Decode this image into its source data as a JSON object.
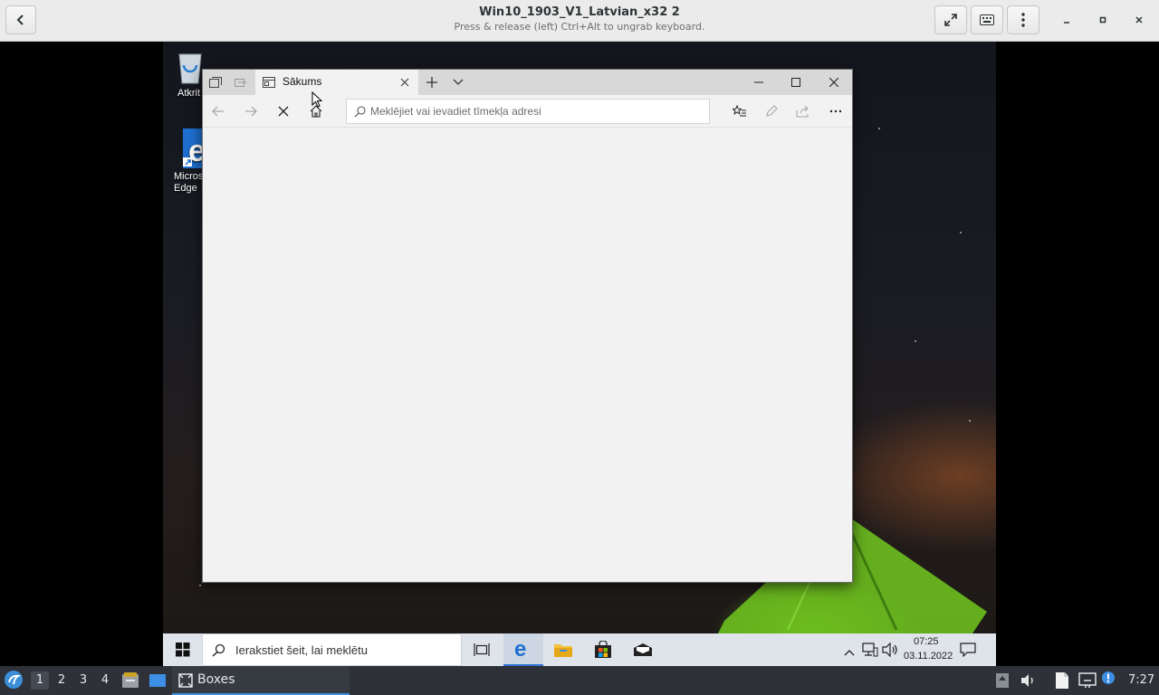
{
  "header": {
    "title": "Win10_1903_V1_Latvian_x32 2",
    "subtitle": "Press & release (left) Ctrl+Alt to ungrab keyboard.",
    "icons": {
      "back": "back-icon",
      "fullscreen": "fullscreen-icon",
      "keyboard": "keyboard-icon",
      "menu": "menu-icon",
      "minimize": "minimize-icon",
      "maximize": "maximize-icon",
      "close": "close-icon"
    }
  },
  "desktop": {
    "icons": [
      {
        "label": "Atkrit",
        "icon": "recycle-bin-icon"
      },
      {
        "label": "Micros Edge",
        "icon": "edge-icon"
      }
    ]
  },
  "edge": {
    "tab": {
      "title": "Sākums"
    },
    "address_placeholder": "Meklējiet vai ievadiet tīmekļa adresi",
    "toolbar_icons": [
      "back-arrow-icon",
      "forward-arrow-icon",
      "stop-icon",
      "home-icon",
      "favorites-icon",
      "pen-icon",
      "share-icon",
      "more-icon"
    ]
  },
  "win_taskbar": {
    "search_placeholder": "Ierakstiet šeit, lai meklētu",
    "time": "07:25",
    "date": "03.11.2022"
  },
  "host_panel": {
    "workspaces": [
      "1",
      "2",
      "3",
      "4"
    ],
    "task_label": "Boxes",
    "clock": "7:27"
  }
}
